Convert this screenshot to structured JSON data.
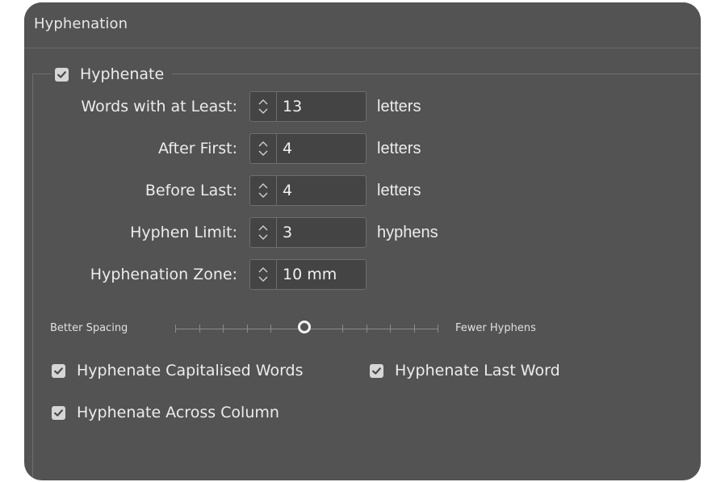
{
  "panel": {
    "title": "Hyphenation"
  },
  "hyphenate": {
    "label": "Hyphenate",
    "checked": true
  },
  "fields": [
    {
      "label": "Words with at Least:",
      "value": "13",
      "unit": "letters"
    },
    {
      "label": "After First:",
      "value": "4",
      "unit": "letters"
    },
    {
      "label": "Before Last:",
      "value": "4",
      "unit": "letters"
    },
    {
      "label": "Hyphen Limit:",
      "value": "3",
      "unit": "hyphens"
    },
    {
      "label": "Hyphenation Zone:",
      "value": "10 mm",
      "unit": ""
    }
  ],
  "slider": {
    "left_label": "Better Spacing",
    "right_label": "Fewer Hyphens",
    "position_fraction": 0.5
  },
  "options": {
    "capitalised": {
      "label": "Hyphenate Capitalised Words",
      "checked": true
    },
    "last_word": {
      "label": "Hyphenate Last Word",
      "checked": true
    },
    "across_column": {
      "label": "Hyphenate Across Column",
      "checked": true
    }
  },
  "icons": {
    "checkbox": "checkmark-icon",
    "stepper": "up-down-chevron-icon"
  },
  "colors": {
    "panel_bg": "#535353",
    "input_bg": "#444444",
    "text": "#ececec",
    "checkbox_bg": "#d6d6d6"
  }
}
